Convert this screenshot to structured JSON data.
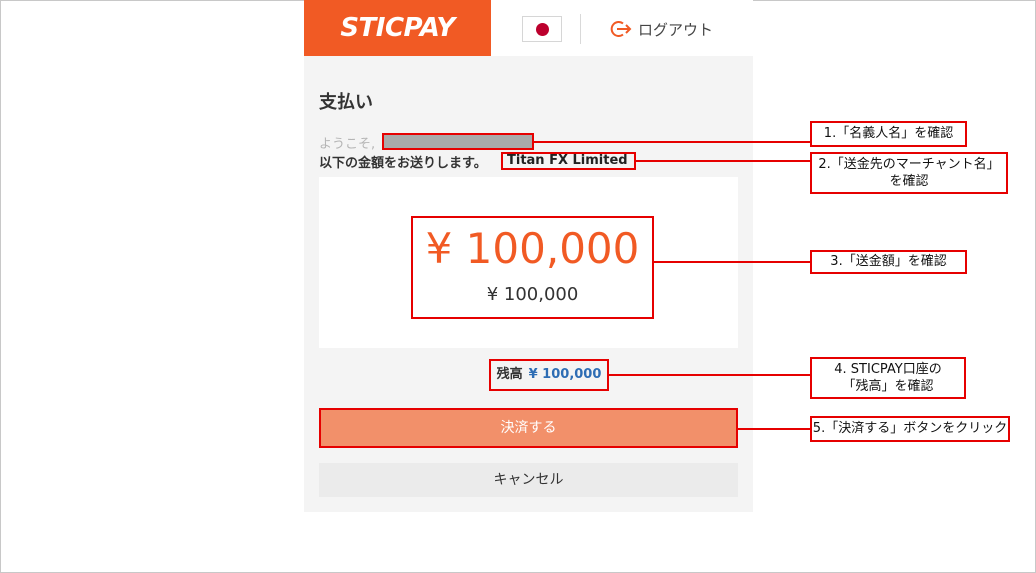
{
  "header": {
    "logo": "STICPAY",
    "logout_label": "ログアウト"
  },
  "colors": {
    "brand": "#f15a24",
    "pay_button": "#f2906a",
    "annotation": "#e60000",
    "balance_value": "#2e6db4"
  },
  "page": {
    "title": "支払い",
    "welcome": "ようこそ,",
    "send_text": "以下の金額をお送りします。",
    "merchant": "Titan FX Limited"
  },
  "amount": {
    "main": "¥ 100,000",
    "sub": "¥ 100,000"
  },
  "balance": {
    "label": "残高",
    "value": "¥ 100,000"
  },
  "buttons": {
    "pay": "決済する",
    "cancel": "キャンセル"
  },
  "annotations": {
    "step1": "1.「名義人名」を確認",
    "step2_line1": "2.「送金先のマーチャント名」",
    "step2_line2": "を確認",
    "step3": "3.「送金額」を確認",
    "step4_line1": "4. STICPAY口座の",
    "step4_line2": "「残高」を確認",
    "step5": "5.「決済する」ボタンをクリック"
  }
}
